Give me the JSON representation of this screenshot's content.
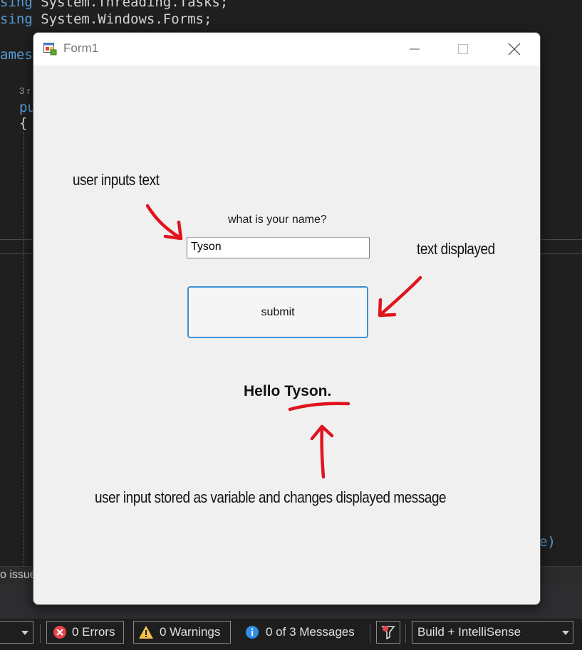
{
  "ide": {
    "code_line_1": {
      "kw": "sing",
      "rest": " System.Threading.Tasks;"
    },
    "code_line_2": {
      "kw": "sing",
      "rest": " System.Windows.Forms;"
    },
    "code_namespace": "amesp",
    "references_hint": "3 r",
    "code_pu": "pu",
    "code_brace": "{",
    "code_right_fragment": "e)",
    "issues_text": "o issue",
    "status": {
      "errors_label": "0 Errors",
      "warnings_label": "0 Warnings",
      "messages_label": "0 of 3 Messages",
      "build_filter": "Build + IntelliSense"
    }
  },
  "form": {
    "title": "Form1",
    "question_label": "what is your name?",
    "name_input_value": "Tyson",
    "submit_label": "submit",
    "greeting_prefix": "Hello ",
    "greeting_name": "Tyson",
    "greeting_suffix": "."
  },
  "annotations": {
    "input_note": "user inputs text",
    "display_note": "text displayed",
    "variable_note": "user input stored as variable and changes displayed message"
  },
  "colors": {
    "annotation_red": "#e0141e",
    "button_border": "#3d8fd1",
    "error_red": "#e5434a",
    "warning_yellow": "#f2c14e",
    "info_blue": "#2f8fe6"
  }
}
